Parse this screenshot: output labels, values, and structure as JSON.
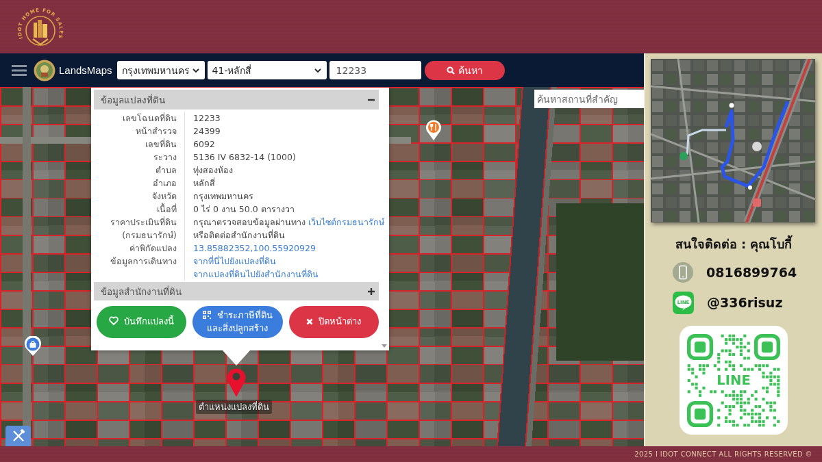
{
  "brand": {
    "logo_text": "IDOT HOME FOR SALES"
  },
  "navbar": {
    "app_name": "LandsMaps",
    "province_select": {
      "value": "กรุงเทพมหานคร"
    },
    "district_select": {
      "value": "41-หลักสี่"
    },
    "parcel_field": {
      "value": "12233"
    },
    "search_button": {
      "label": "ค้นหา"
    }
  },
  "map": {
    "place_search": {
      "placeholder": "ค้นหาสถานที่สำคัญ"
    },
    "marker_label": "ตำแหน่งแปลงที่ดิน"
  },
  "parcel_popup": {
    "sections": [
      {
        "title": "ข้อมูลแปลงที่ดิน",
        "expanded": true,
        "rows": [
          {
            "label": "เลขโฉนดที่ดิน",
            "text": "12233"
          },
          {
            "label": "หน้าสำรวจ",
            "text": "24399"
          },
          {
            "label": "เลขที่ดิน",
            "text": "6092"
          },
          {
            "label": "ระวาง",
            "text": "5136 IV 6832-14 (1000)"
          },
          {
            "label": "ตำบล",
            "text": "ทุ่งสองห้อง"
          },
          {
            "label": "อำเภอ",
            "text": "หลักสี่"
          },
          {
            "label": "จังหวัด",
            "text": "กรุงเทพมหานคร"
          },
          {
            "label": "เนื้อที่",
            "text": "0 ไร่ 0 งาน 50.0 ตารางวา"
          },
          {
            "label": "ราคาประเมินที่ดิน",
            "text": "กรุณาตรวจสอบข้อมูลผ่านทาง",
            "link": "เว็บไซต์กรมธนารักษ์"
          },
          {
            "label": "(กรมธนารักษ์)",
            "text": "หรือติดต่อสำนักงานที่ดิน"
          },
          {
            "label": "ค่าพิกัดแปลง",
            "link": "13.85882352,100.55920929"
          },
          {
            "label": "ข้อมูลการเดินทาง",
            "link": "จากที่นี่ไปยังแปลงที่ดิน"
          },
          {
            "link": "จากแปลงที่ดินไปยังสำนักงานที่ดิน"
          }
        ]
      },
      {
        "title": "ข้อมูลสำนักงานที่ดิน",
        "expanded": false
      }
    ],
    "buttons": [
      {
        "kind": "save",
        "label": "บันทึกแปลงนี้"
      },
      {
        "kind": "tax",
        "label": "ชำระภาษีที่ดินและสิ่งปลูกสร้าง"
      },
      {
        "kind": "close",
        "label": "ปิดหน้าต่าง"
      }
    ]
  },
  "contact": {
    "title": "สนใจติดต่อ : คุณโบกี้",
    "items": [
      {
        "kind": "phone",
        "text": "0816899764"
      },
      {
        "kind": "line",
        "text": "@336risuz",
        "logo_text": "LINE"
      }
    ],
    "qr": {
      "logo_text": "LINE"
    }
  },
  "footer": {
    "text": "2025 I IDOT CONNECT ALL RIGHTS RESERVED ©"
  }
}
